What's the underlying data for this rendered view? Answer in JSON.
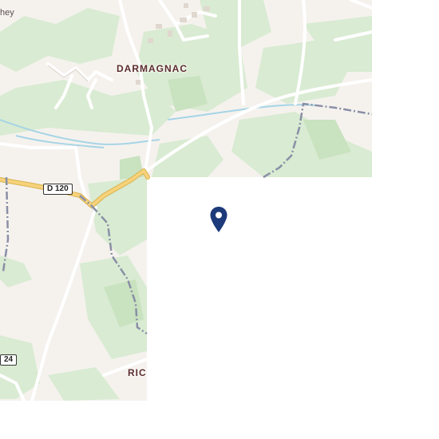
{
  "map": {
    "labels": {
      "town": "DARMAGNAC",
      "partial_town": "RIC",
      "partial_corner": "hey"
    },
    "roads": {
      "d120": "D 120",
      "d24_partial": "24"
    },
    "marker": {
      "icon": "map-pin-icon",
      "color": "#1d3a7a"
    },
    "colors": {
      "land": "#f5f2ee",
      "green": "#d9ebd2",
      "green_dark": "#c9e2bf",
      "water": "#a6d4e6",
      "road_major": "#f6d27a",
      "road_minor": "#ffffff",
      "boundary": "#8a8fa6",
      "blank_tile": "#ffffff"
    }
  }
}
